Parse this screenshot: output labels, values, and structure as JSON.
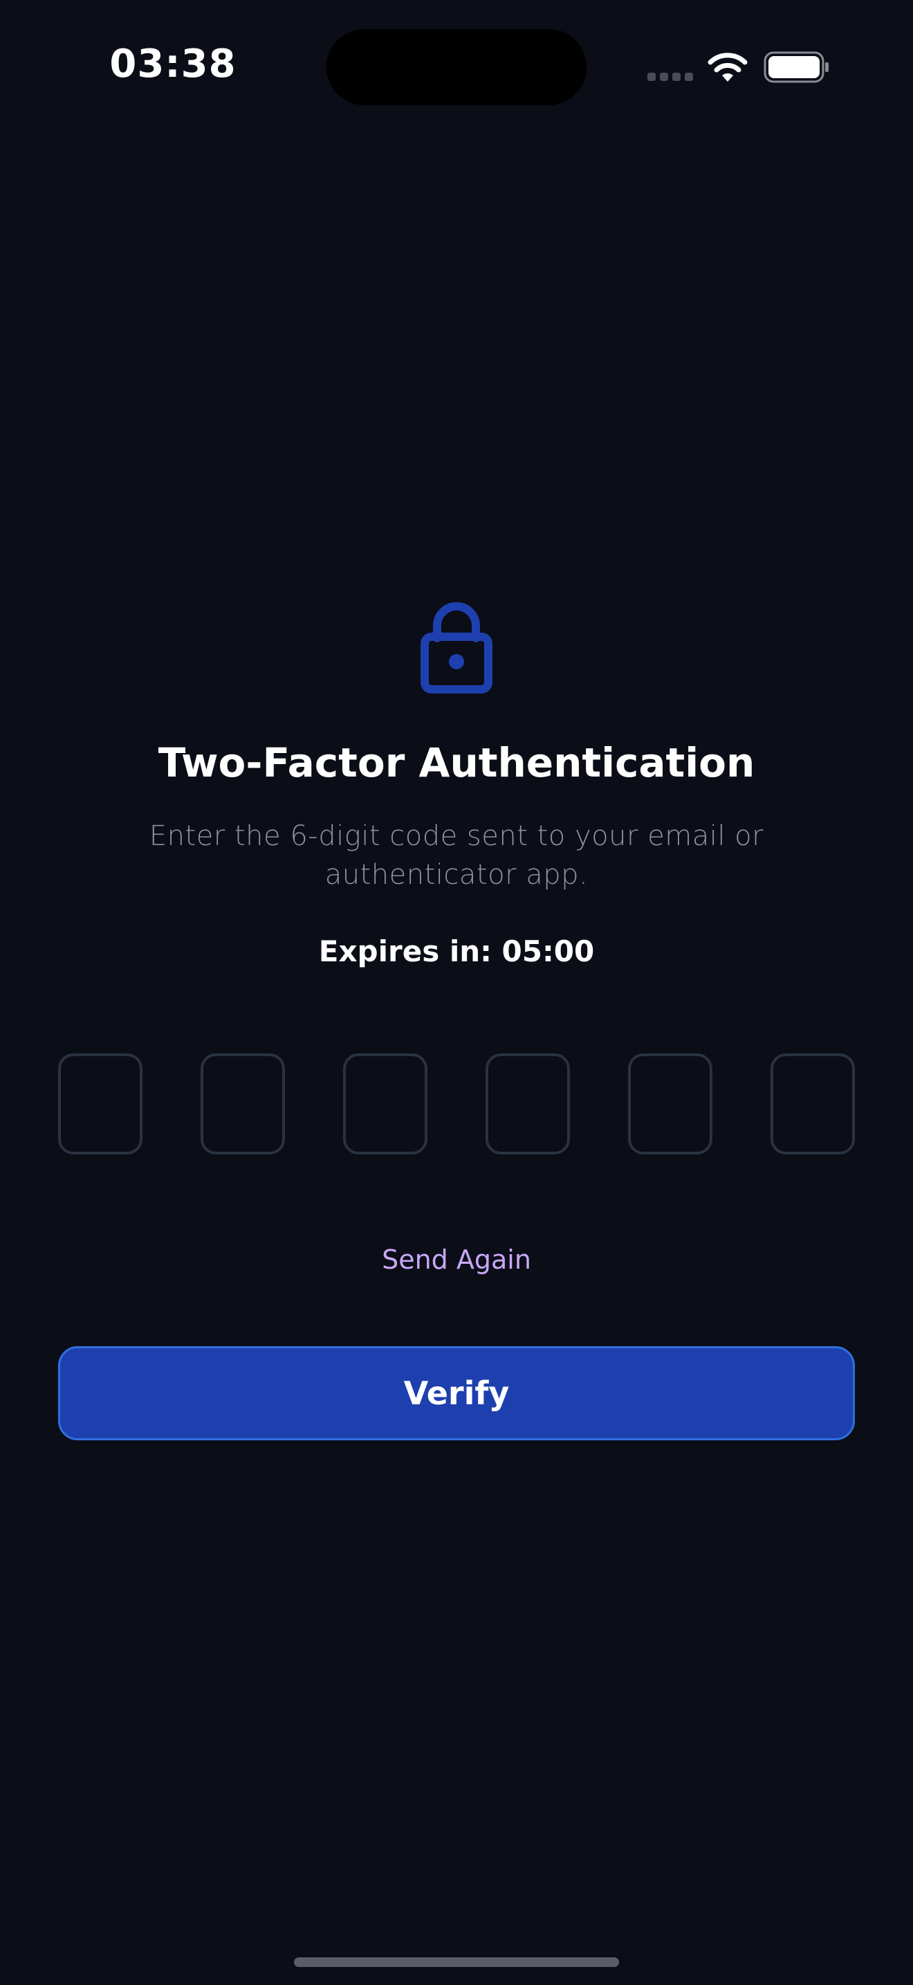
{
  "status_bar": {
    "time": "03:38",
    "signal_icon": "cellular-signal-icon",
    "wifi_icon": "wifi-icon",
    "battery_icon": "battery-icon"
  },
  "header": {
    "icon": "lock-icon",
    "title": "Two-Factor Authentication",
    "subtitle": "Enter the 6-digit code sent to your email or authenticator app."
  },
  "timer": {
    "text": "Expires in: 05:00"
  },
  "code_input": {
    "digits": [
      "",
      "",
      "",
      "",
      "",
      ""
    ]
  },
  "actions": {
    "send_again_label": "Send Again",
    "verify_label": "Verify"
  },
  "colors": {
    "background": "#0b0d17",
    "accent": "#1e40af",
    "accent_border": "#2f6fe0",
    "link": "#c8a8f5",
    "muted_text": "#8d93a6",
    "input_border": "#2a3242"
  }
}
